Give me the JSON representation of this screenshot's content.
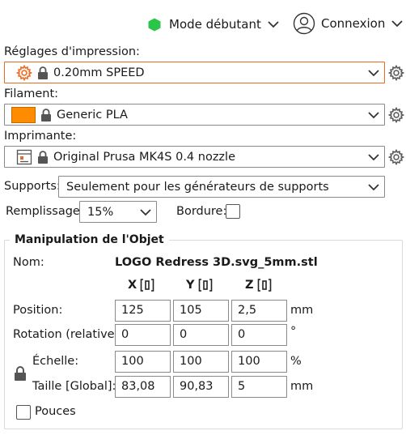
{
  "topbar": {
    "mode_label": "Mode débutant",
    "mode_color": "#2bc54a",
    "login_label": "Connexion"
  },
  "print_settings": {
    "label": "Réglages d'impression:",
    "value": "0.20mm SPEED",
    "icon": "gear-icon"
  },
  "filament": {
    "label": "Filament:",
    "value": "Generic PLA",
    "swatch_color": "#ff8c00"
  },
  "printer": {
    "label": "Imprimante:",
    "value": "Original Prusa MK4S 0.4 nozzle"
  },
  "supports": {
    "label": "Supports:",
    "value": "Seulement pour les générateurs de supports"
  },
  "infill": {
    "label": "Remplissage:",
    "value": "15%"
  },
  "brim": {
    "label": "Bordure:",
    "checked": false
  },
  "object_manipulation": {
    "title": "Manipulation de l'Objet",
    "name_label": "Nom:",
    "name_value": "LOGO Redress 3D.svg_5mm.stl",
    "axes": [
      "X",
      "Y",
      "Z"
    ],
    "rows": [
      {
        "label": "Position:",
        "values": [
          "125",
          "105",
          "2,5"
        ],
        "unit": "mm"
      },
      {
        "label": "Rotation (relative):",
        "values": [
          "0",
          "0",
          "0"
        ],
        "unit": "°"
      },
      {
        "label": "Échelle:",
        "values": [
          "100",
          "100",
          "100"
        ],
        "unit": "%"
      },
      {
        "label": "Taille [Global]:",
        "values": [
          "83,08",
          "90,83",
          "5"
        ],
        "unit": "mm"
      }
    ],
    "inches_label": "Pouces"
  },
  "colors": {
    "accent": "#ed6b21",
    "border": "#8a8a8a"
  }
}
